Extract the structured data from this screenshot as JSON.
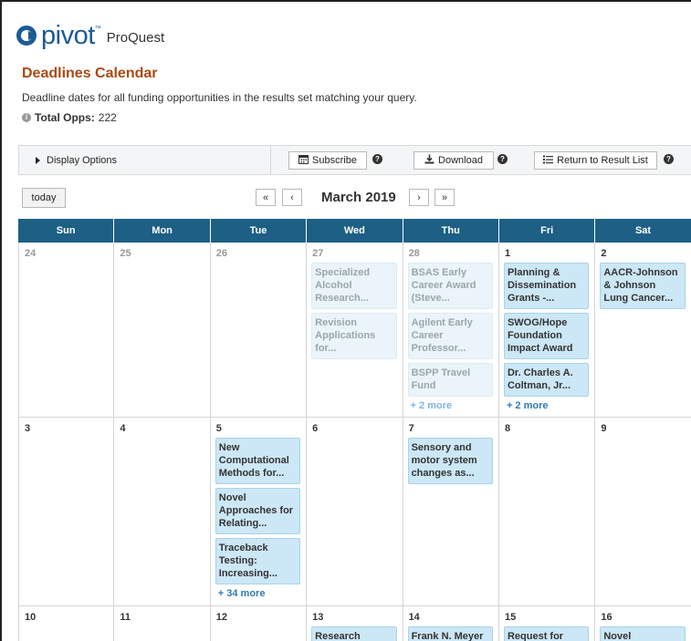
{
  "brand": {
    "logo_word": "pivot",
    "tm": "™",
    "sub": "ProQuest"
  },
  "page": {
    "title": "Deadlines Calendar",
    "description": "Deadline dates for all funding opportunities in the results set matching your query.",
    "total_label": "Total Opps:",
    "total_value": "222",
    "info_icon": "i"
  },
  "toolbar": {
    "display_options": "Display Options",
    "subscribe": "Subscribe",
    "download": "Download",
    "return": "Return to Result List",
    "help": "?"
  },
  "nav": {
    "today": "today",
    "prev_year": "«",
    "prev_month": "‹",
    "month": "March 2019",
    "next_month": "›",
    "next_year": "»"
  },
  "weekdays": [
    "Sun",
    "Mon",
    "Tue",
    "Wed",
    "Thu",
    "Fri",
    "Sat"
  ],
  "weeks": [
    {
      "days": [
        {
          "num": "24",
          "other": true,
          "events": []
        },
        {
          "num": "25",
          "other": true,
          "events": []
        },
        {
          "num": "26",
          "other": true,
          "events": []
        },
        {
          "num": "27",
          "other": true,
          "events": [
            "Specialized Alcohol Research...",
            "Revision Applications for..."
          ]
        },
        {
          "num": "28",
          "other": true,
          "events": [
            "BSAS Early Career Award (Steve...",
            "Agilent Early Career Professor...",
            "BSPP Travel Fund"
          ],
          "more": "+ 2 more"
        },
        {
          "num": "1",
          "other": false,
          "events": [
            "Planning & Dissemination Grants -...",
            "SWOG/Hope Foundation Impact Award",
            "Dr. Charles A. Coltman, Jr..."
          ],
          "more": "+ 2 more"
        },
        {
          "num": "2",
          "other": false,
          "events": [
            "AACR-Johnson & Johnson Lung Cancer..."
          ]
        }
      ]
    },
    {
      "days": [
        {
          "num": "3",
          "other": false,
          "events": []
        },
        {
          "num": "4",
          "other": false,
          "events": []
        },
        {
          "num": "5",
          "other": false,
          "events": [
            "New Computational Methods for...",
            "Novel Approaches for Relating...",
            "Traceback Testing: Increasing..."
          ],
          "more": "+ 34 more"
        },
        {
          "num": "6",
          "other": false,
          "events": []
        },
        {
          "num": "7",
          "other": false,
          "events": [
            "Sensory and motor system changes as..."
          ]
        },
        {
          "num": "8",
          "other": false,
          "events": []
        },
        {
          "num": "9",
          "other": false,
          "events": []
        }
      ]
    },
    {
      "days": [
        {
          "num": "10",
          "other": false,
          "events": []
        },
        {
          "num": "11",
          "other": false,
          "events": []
        },
        {
          "num": "12",
          "other": false,
          "events": []
        },
        {
          "num": "13",
          "other": false,
          "events": [
            "Research"
          ]
        },
        {
          "num": "14",
          "other": false,
          "events": [
            "Frank N. Meyer"
          ]
        },
        {
          "num": "15",
          "other": false,
          "events": [
            "Request for Basic"
          ]
        },
        {
          "num": "16",
          "other": false,
          "events": [
            "Novel"
          ]
        }
      ]
    }
  ]
}
